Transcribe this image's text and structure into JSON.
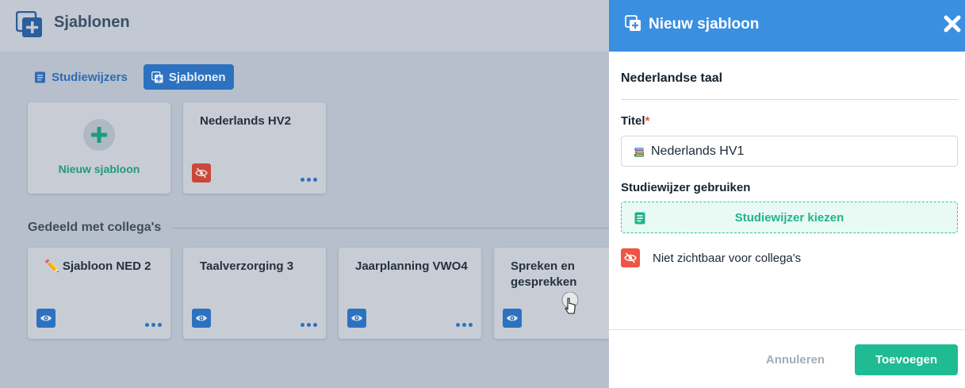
{
  "app": {
    "page_title": "Sjablonen",
    "tabs": [
      {
        "label": "Studiewijzers",
        "active": false
      },
      {
        "label": "Sjablonen",
        "active": true
      }
    ],
    "new_template_label": "Nieuw sjabloon",
    "my_templates": [
      {
        "title": "Nederlands HV2",
        "visibility": "hidden"
      }
    ],
    "shared_section_label": "Gedeeld met collega's",
    "shared_templates": [
      {
        "title": "✏️ Sjabloon NED 2",
        "visibility": "visible"
      },
      {
        "title": "Taalverzorging 3",
        "visibility": "visible"
      },
      {
        "title": "Jaarplanning VWO4",
        "visibility": "visible"
      },
      {
        "title": "Spreken en gesprekken",
        "visibility": "visible"
      }
    ]
  },
  "panel": {
    "title": "Nieuw sjabloon",
    "subject": "Nederlandse taal",
    "title_field": {
      "label": "Titel",
      "required_marker": "*",
      "value": "Nederlands HV1"
    },
    "studiewijzer_field": {
      "label": "Studiewijzer gebruiken",
      "button_label": "Studiewijzer kiezen"
    },
    "visibility_text": "Niet zichtbaar voor collega's",
    "cancel_label": "Annuleren",
    "add_label": "Toevoegen"
  },
  "colors": {
    "header_blue": "#3a8fe0",
    "accent_green": "#1fbc93",
    "hidden_red": "#f05543",
    "tab_blue": "#2c72c0"
  },
  "icons": [
    "template-add-icon",
    "list-icon",
    "plus-icon",
    "eye-icon",
    "eye-slash-icon",
    "close-icon",
    "books-icon",
    "pointer-cursor-icon"
  ]
}
